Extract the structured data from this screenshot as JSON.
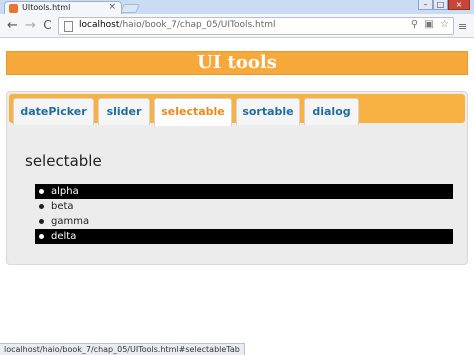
{
  "browser": {
    "tab_title": "UItools.html",
    "tab_close": "×",
    "window_controls": {
      "minimize": "–",
      "maximize": "□",
      "close": "×"
    },
    "nav": {
      "back": "←",
      "forward": "→",
      "reload": "C"
    },
    "url_host": "localhost",
    "url_path": "/haio/book_7/chap_05/UITools.html",
    "omnibox_icons": {
      "search": "⚲",
      "extension": "▣",
      "bookmark": "☆"
    },
    "wrench": "≡",
    "status_text": "localhost/haio/book_7/chap_05/UITools.html#selectableTab"
  },
  "page": {
    "header_title": "UI tools",
    "tabs": [
      {
        "label": "datePicker",
        "active": false
      },
      {
        "label": "slider",
        "active": false
      },
      {
        "label": "selectable",
        "active": true
      },
      {
        "label": "sortable",
        "active": false
      },
      {
        "label": "dialog",
        "active": false
      }
    ],
    "panel": {
      "title": "selectable",
      "items": [
        {
          "label": "alpha",
          "selected": true
        },
        {
          "label": "beta",
          "selected": false
        },
        {
          "label": "gamma",
          "selected": false
        },
        {
          "label": "delta",
          "selected": true
        }
      ]
    }
  },
  "colors": {
    "header_orange": "#f7a83a",
    "tab_link_blue": "#1c6ea3",
    "active_tab_orange": "#e88a18",
    "selected_bg": "#000000"
  }
}
